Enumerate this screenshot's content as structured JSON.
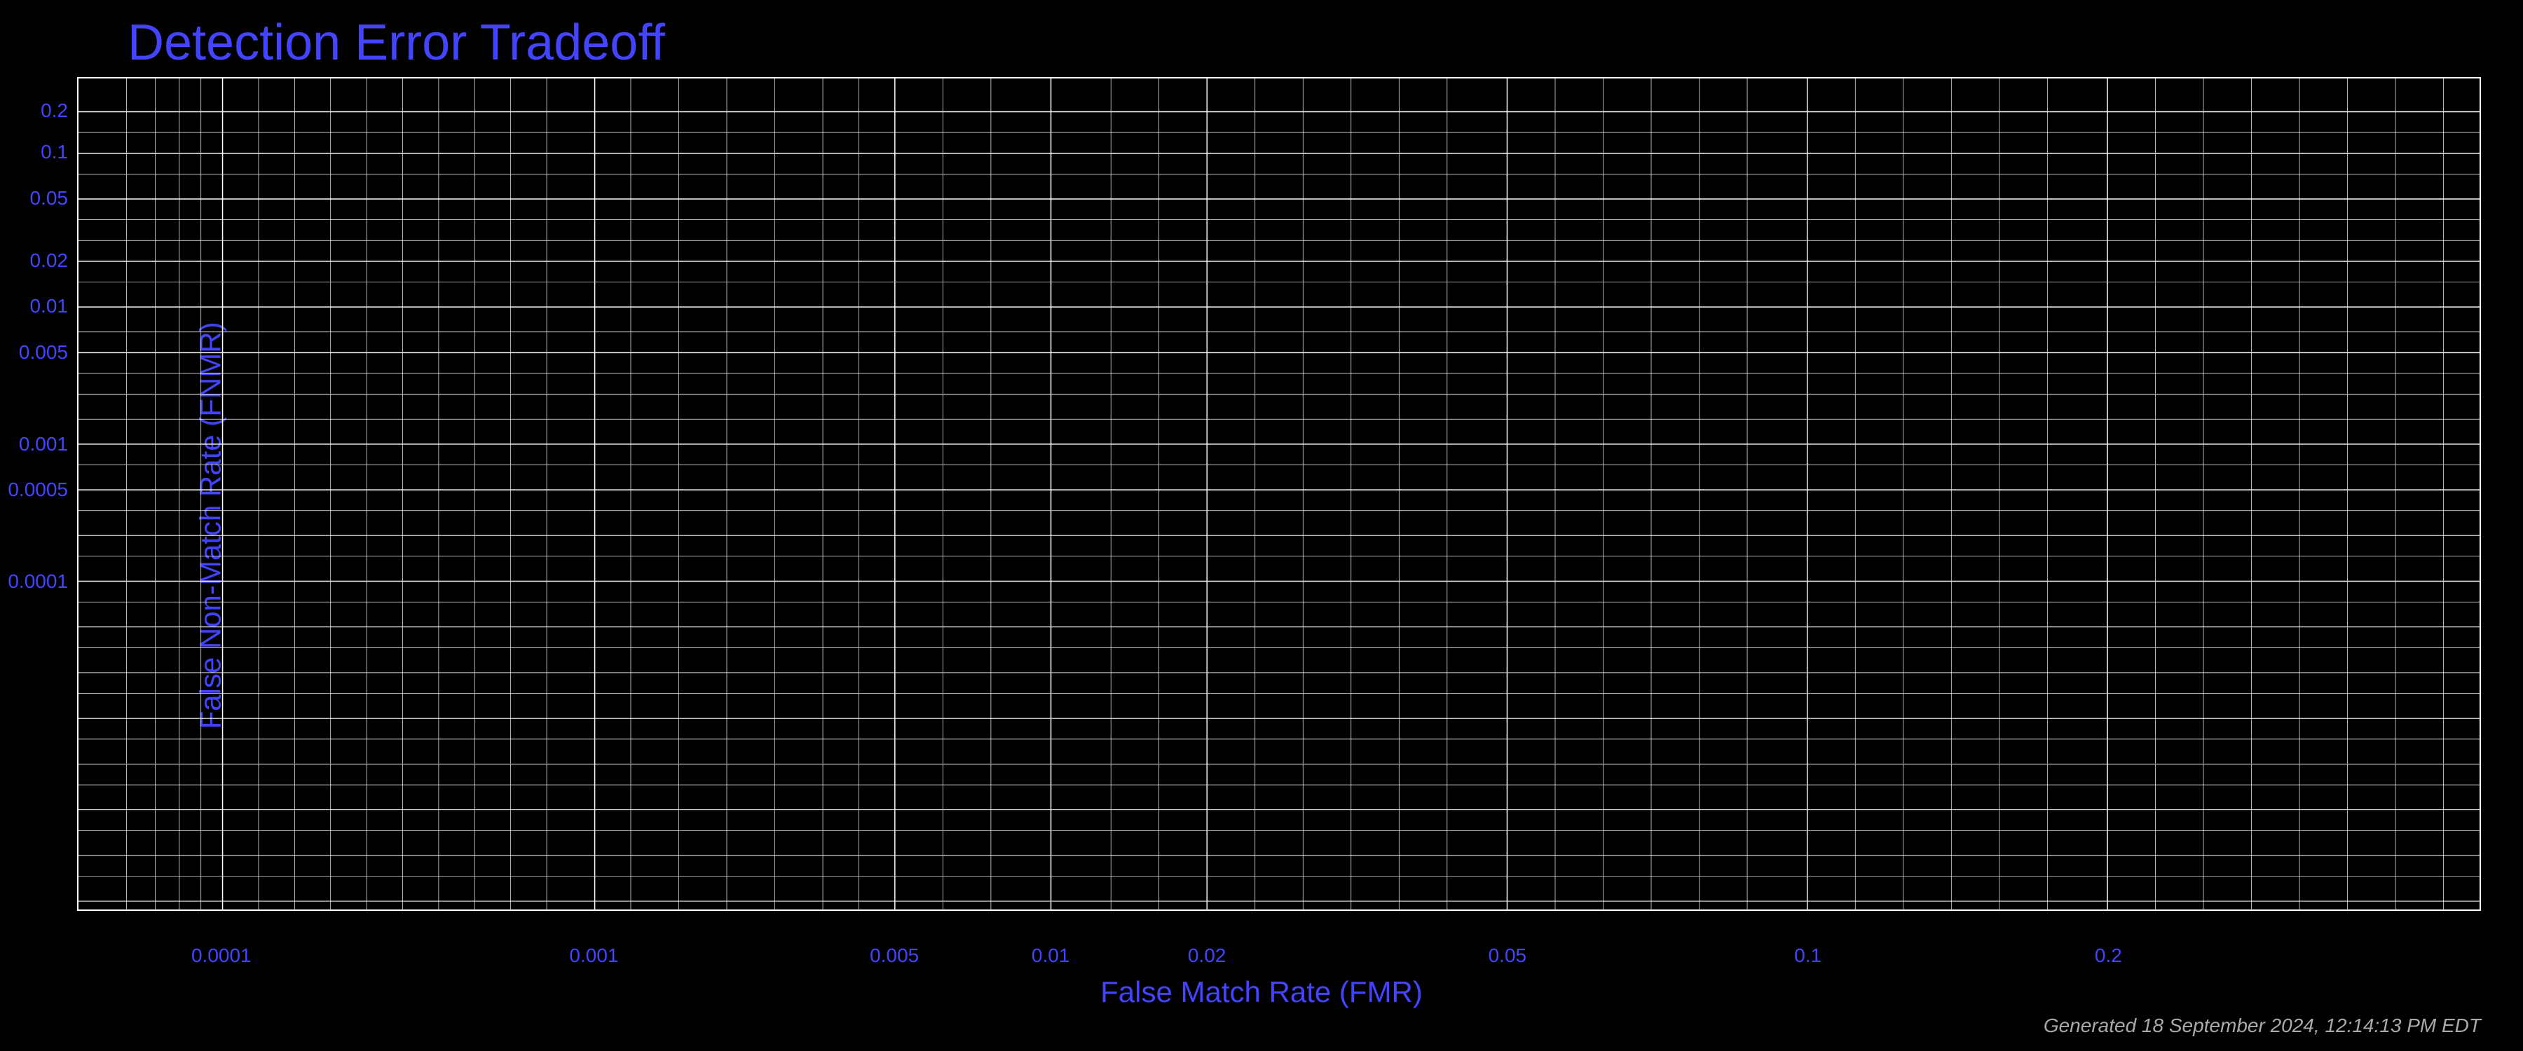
{
  "title": "Detection Error Tradeoff",
  "chart": {
    "background": "#000000",
    "grid_color": "#ffffff",
    "y_axis_label": "False Non-Match Rate (FNMR)",
    "x_axis_label": "False Match Rate (FMR)",
    "y_ticks": [
      {
        "label": "0.2",
        "frac": 0.04
      },
      {
        "label": "0.1",
        "frac": 0.09
      },
      {
        "label": "0.05",
        "frac": 0.145
      },
      {
        "label": "0.02",
        "frac": 0.22
      },
      {
        "label": "0.01",
        "frac": 0.275
      },
      {
        "label": "0.005",
        "frac": 0.33
      },
      {
        "label": "0.001",
        "frac": 0.44
      },
      {
        "label": "0.0005",
        "frac": 0.495
      },
      {
        "label": "0.0001",
        "frac": 0.605
      },
      {
        "label": "",
        "frac": 0.66
      },
      {
        "label": "",
        "frac": 0.715
      },
      {
        "label": "",
        "frac": 0.77
      },
      {
        "label": "",
        "frac": 0.825
      },
      {
        "label": "",
        "frac": 0.88
      },
      {
        "label": "",
        "frac": 0.935
      }
    ],
    "x_ticks": [
      {
        "label": "0.0001",
        "frac": 0.06
      },
      {
        "label": "0.001",
        "frac": 0.215
      },
      {
        "label": "0.005",
        "frac": 0.34
      },
      {
        "label": "0.01",
        "frac": 0.405
      },
      {
        "label": "0.02",
        "frac": 0.47
      },
      {
        "label": "0.05",
        "frac": 0.595
      },
      {
        "label": "0.1",
        "frac": 0.72
      },
      {
        "label": "0.2",
        "frac": 0.845
      }
    ]
  },
  "generated_text": "Generated 18 September 2024, 12:14:13 PM EDT"
}
